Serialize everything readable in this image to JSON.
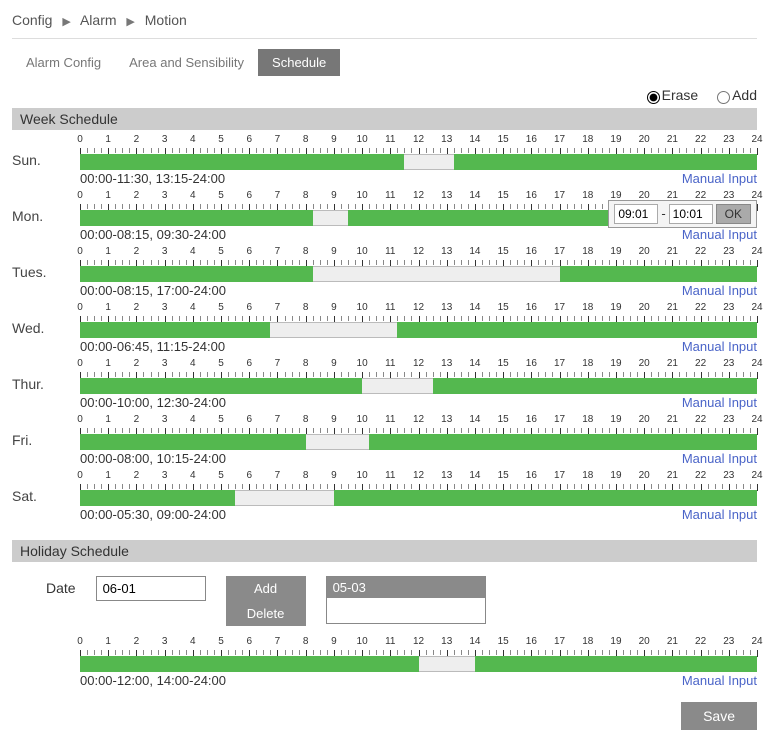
{
  "breadcrumb": {
    "a": "Config",
    "b": "Alarm",
    "c": "Motion"
  },
  "tabs": {
    "alarm": "Alarm Config",
    "area": "Area and Sensibility",
    "schedule": "Schedule"
  },
  "mode": {
    "erase": "Erase",
    "add": "Add"
  },
  "section": {
    "week": "Week Schedule",
    "holiday": "Holiday Schedule"
  },
  "manual_link": "Manual Input",
  "manual_popup": {
    "from": "09:01",
    "to": "10:01",
    "ok": "OK"
  },
  "holiday": {
    "date_label": "Date",
    "date_value": "06-01",
    "add": "Add",
    "delete": "Delete",
    "list_selected": "05-03"
  },
  "save": "Save",
  "days": [
    {
      "label": "Sun.",
      "text": "00:00-11:30,   13:15-24:00",
      "segs": [
        [
          0,
          11.5
        ],
        [
          13.25,
          24
        ]
      ],
      "popup": false
    },
    {
      "label": "Mon.",
      "text": "00:00-08:15,   09:30-24:00",
      "segs": [
        [
          0,
          8.25
        ],
        [
          9.5,
          24
        ]
      ],
      "popup": true
    },
    {
      "label": "Tues.",
      "text": "00:00-08:15,   17:00-24:00",
      "segs": [
        [
          0,
          8.25
        ],
        [
          17,
          24
        ]
      ],
      "popup": false
    },
    {
      "label": "Wed.",
      "text": "00:00-06:45,   11:15-24:00",
      "segs": [
        [
          0,
          6.75
        ],
        [
          11.25,
          24
        ]
      ],
      "popup": false
    },
    {
      "label": "Thur.",
      "text": "00:00-10:00,   12:30-24:00",
      "segs": [
        [
          0,
          10
        ],
        [
          12.5,
          24
        ]
      ],
      "popup": false
    },
    {
      "label": "Fri.",
      "text": "00:00-08:00,   10:15-24:00",
      "segs": [
        [
          0,
          8
        ],
        [
          10.25,
          24
        ]
      ],
      "popup": false
    },
    {
      "label": "Sat.",
      "text": "00:00-05:30,   09:00-24:00",
      "segs": [
        [
          0,
          5.5
        ],
        [
          9,
          24
        ]
      ],
      "popup": false
    }
  ],
  "holiday_bar": {
    "text": "00:00-12:00,   14:00-24:00",
    "segs": [
      [
        0,
        12
      ],
      [
        14,
        24
      ]
    ]
  }
}
